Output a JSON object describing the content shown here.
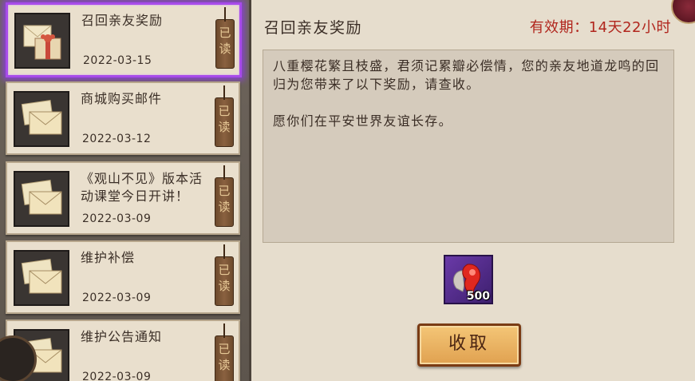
{
  "mail_list": [
    {
      "title": "召回亲友奖励",
      "date": "2022-03-15",
      "status": "已读",
      "selected": true,
      "icon": "gift-package-icon"
    },
    {
      "title": "商城购买邮件",
      "date": "2022-03-12",
      "status": "已读",
      "selected": false,
      "icon": "envelope-icon"
    },
    {
      "title": "《观山不见》版本活动课堂今日开讲！",
      "date": "2022-03-09",
      "status": "已读",
      "selected": false,
      "icon": "envelope-icon"
    },
    {
      "title": "维护补偿",
      "date": "2022-03-09",
      "status": "已读",
      "selected": false,
      "icon": "envelope-icon"
    },
    {
      "title": "维护公告通知",
      "date": "2022-03-09",
      "status": "已读",
      "selected": false,
      "icon": "envelope-icon"
    }
  ],
  "detail": {
    "title": "召回亲友奖励",
    "validity_label": "有效期：",
    "validity_value": "14天22小时",
    "body_p1": "八重樱花繁且枝盛，君须记累瓣必偿情，您的亲友地道龙鸣的回归为您带来了以下奖励，请查收。",
    "body_p2": "愿你们在平安世界友谊长存。",
    "reward": {
      "icon": "red-magatama-icon",
      "quantity": "500"
    },
    "collect_label": "收取"
  },
  "colors": {
    "selected_border": "#a84bea",
    "validity": "#b1261d",
    "button": "#e0a150"
  }
}
